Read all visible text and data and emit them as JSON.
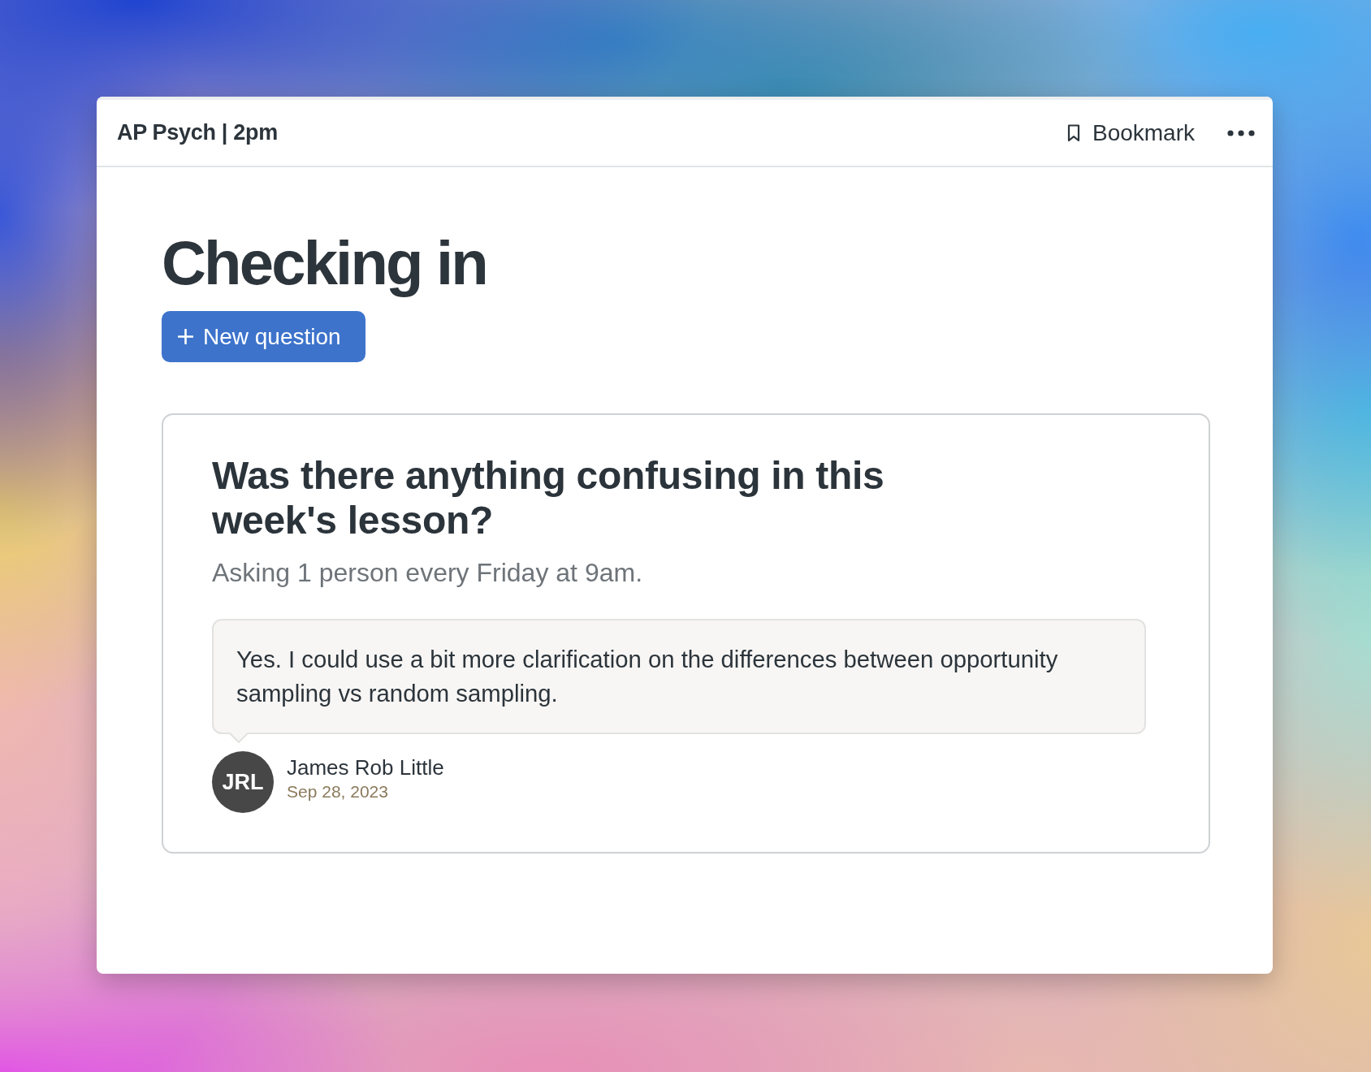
{
  "header": {
    "title": "AP Psych | 2pm",
    "bookmark_label": "Bookmark"
  },
  "page": {
    "title": "Checking in",
    "new_question_label": "New question"
  },
  "question": {
    "title": "Was there anything confusing in this week's lesson?",
    "schedule": "Asking 1 person every Friday at 9am.",
    "responses": [
      {
        "text": "Yes. I could use a bit more clarification on the differences between opportunity sampling vs random sampling.",
        "author_initials": "JRL",
        "author_name": "James Rob Little",
        "date": "Sep 28, 2023"
      }
    ]
  }
}
